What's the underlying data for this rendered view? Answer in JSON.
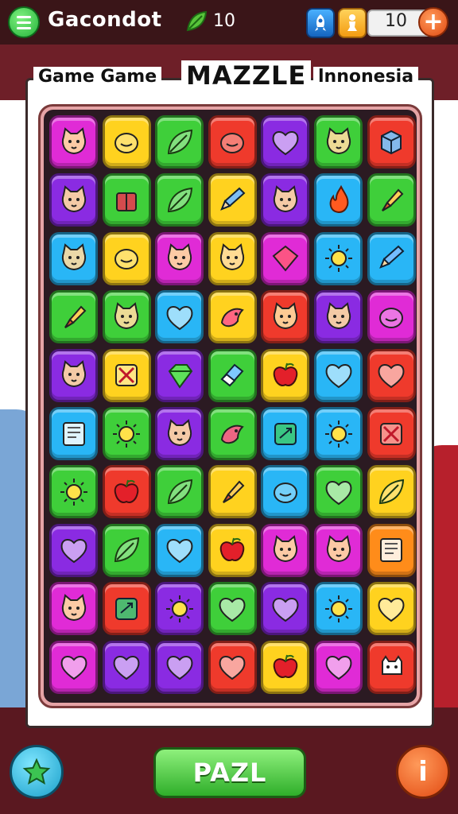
{
  "topbar": {
    "title": "Gacondot",
    "leaf_count": "10",
    "coin_count": "10",
    "plus_label": "+"
  },
  "header": {
    "left": "Game Game",
    "center": "MAZZLE",
    "right": "lnnonesia"
  },
  "buttons": {
    "play_label": "PAZL",
    "info_label": "i"
  },
  "colors": {
    "magenta": "#e02bd6",
    "yellow": "#ffd21f",
    "green": "#3fcf3a",
    "red": "#ef3a2c",
    "purple": "#8a2be2",
    "cyan": "#29b6f6",
    "orange": "#ff8c1a"
  },
  "board": {
    "rows": [
      [
        "magenta:cat-face",
        "yellow:blob",
        "green:leaf",
        "red:blob",
        "purple:heart",
        "green:cat-face",
        "red:cube"
      ],
      [
        "purple:cat-face",
        "green:gift",
        "green:leaf",
        "yellow:pencil",
        "purple:cat-face",
        "cyan:fire",
        "green:brush"
      ],
      [
        "cyan:cat-face",
        "yellow:blob",
        "magenta:cat-face",
        "yellow:cat-face",
        "magenta:diamond",
        "cyan:sun",
        "cyan:pencil"
      ],
      [
        "green:brush",
        "green:cat-face",
        "cyan:heart",
        "yellow:bird",
        "red:cat-face",
        "purple:cat-face",
        "magenta:blob"
      ],
      [
        "purple:cat-face",
        "yellow:box",
        "purple:gem",
        "green:eraser",
        "yellow:apple",
        "cyan:heart",
        "red:heart"
      ],
      [
        "cyan:book",
        "green:sun",
        "purple:cat-face",
        "green:bird",
        "cyan:note",
        "cyan:sun",
        "red:box"
      ],
      [
        "green:sun",
        "red:apple",
        "green:leaf",
        "yellow:brush",
        "cyan:blob",
        "green:heart",
        "yellow:leaf"
      ],
      [
        "purple:heart",
        "green:leaf",
        "cyan:heart",
        "yellow:apple",
        "magenta:cat-face",
        "magenta:cat-face",
        "orange:book"
      ],
      [
        "magenta:cat-face",
        "red:note",
        "purple:sun",
        "green:heart",
        "purple:heart",
        "cyan:sun",
        "yellow:heart"
      ],
      [
        "magenta:heart",
        "purple:heart",
        "purple:heart",
        "red:heart",
        "yellow:apple",
        "magenta:heart",
        "red:dog"
      ]
    ]
  }
}
